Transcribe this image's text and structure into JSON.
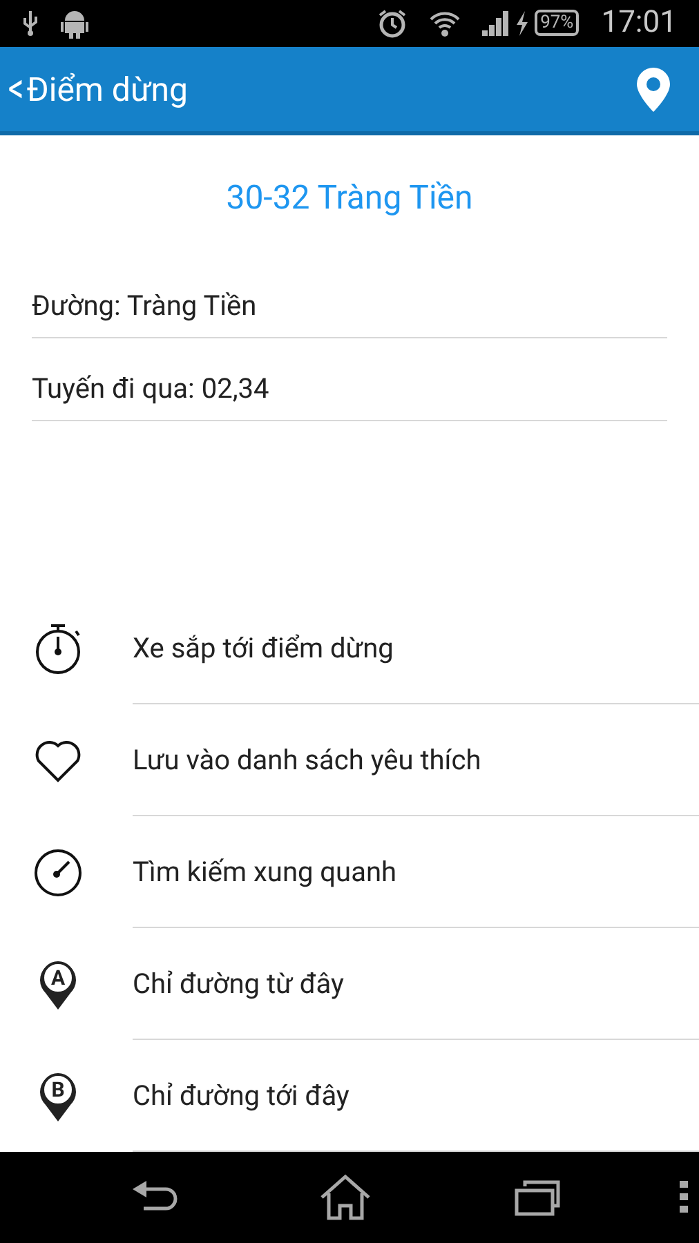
{
  "status_bar": {
    "battery": "97%",
    "time": "17:01"
  },
  "app_bar": {
    "back": "<",
    "title": "Điểm dừng"
  },
  "stop_name": "30-32 Tràng Tiền",
  "info": [
    {
      "text": "Đường: Tràng Tiền"
    },
    {
      "text": "Tuyến đi qua: 02,34"
    }
  ],
  "actions": [
    {
      "kind": "stopwatch",
      "label": "Xe sắp tới điểm dừng"
    },
    {
      "kind": "heart",
      "label": "Lưu vào danh sách yêu thích"
    },
    {
      "kind": "gauge",
      "label": "Tìm kiếm xung quanh"
    },
    {
      "kind": "pin",
      "badge": "A",
      "label": "Chỉ đường từ đây"
    },
    {
      "kind": "pin",
      "badge": "B",
      "label": "Chỉ đường tới đây"
    }
  ]
}
